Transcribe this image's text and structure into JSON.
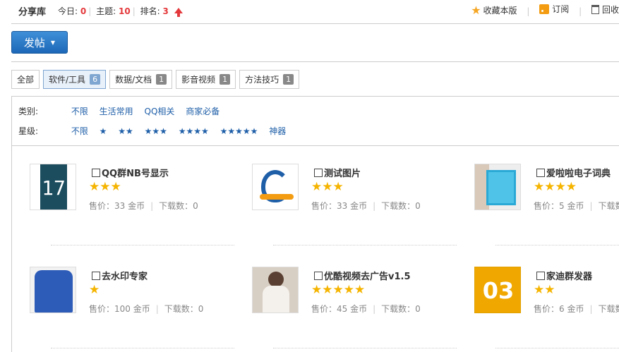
{
  "header": {
    "title": "分享库",
    "today_label": "今日:",
    "today_value": "0",
    "topics_label": "主题:",
    "topics_value": "10",
    "rank_label": "排名:",
    "rank_value": "3",
    "actions": [
      "收藏本版",
      "订阅",
      "回收"
    ]
  },
  "post_button": "发帖",
  "tabs": [
    {
      "label": "全部",
      "count": ""
    },
    {
      "label": "软件/工具",
      "count": "6"
    },
    {
      "label": "数据/文档",
      "count": "1"
    },
    {
      "label": "影音视频",
      "count": "1"
    },
    {
      "label": "方法技巧",
      "count": "1"
    }
  ],
  "filters": {
    "category_label": "类别:",
    "categories": [
      "不限",
      "生活常用",
      "QQ相关",
      "商家必备"
    ],
    "rating_label": "星级:",
    "ratings": [
      "不限",
      "★",
      "★★",
      "★★★",
      "★★★★",
      "★★★★★",
      "神器"
    ]
  },
  "items": [
    {
      "name": "QQ群NB号显示",
      "stars": "★★★",
      "price": "售价：33 金币",
      "downloads": "下载数：0"
    },
    {
      "name": "测试图片",
      "stars": "★★★",
      "price": "售价：33 金币",
      "downloads": "下载数：0"
    },
    {
      "name": "爱啦啦电子词典",
      "stars": "★★★★",
      "price": "售价：5 金币",
      "downloads": "下载数"
    },
    {
      "name": "去水印专家",
      "stars": "★",
      "price": "售价：100 金币",
      "downloads": "下载数：0"
    },
    {
      "name": "优酷视频去广告v1.5",
      "stars": "★★★★★",
      "price": "售价：45 金币",
      "downloads": "下载数：0"
    },
    {
      "name": "家迪群发器",
      "stars": "★★",
      "price": "售价：6 金币",
      "downloads": "下载数"
    }
  ],
  "thumb_texts": {
    "item1": "17",
    "item6": "03"
  },
  "colors": {
    "accent_blue": "#1d68b8",
    "count_red": "#e4393c",
    "star_gold": "#f5b400",
    "link_blue": "#1f5fa8"
  }
}
